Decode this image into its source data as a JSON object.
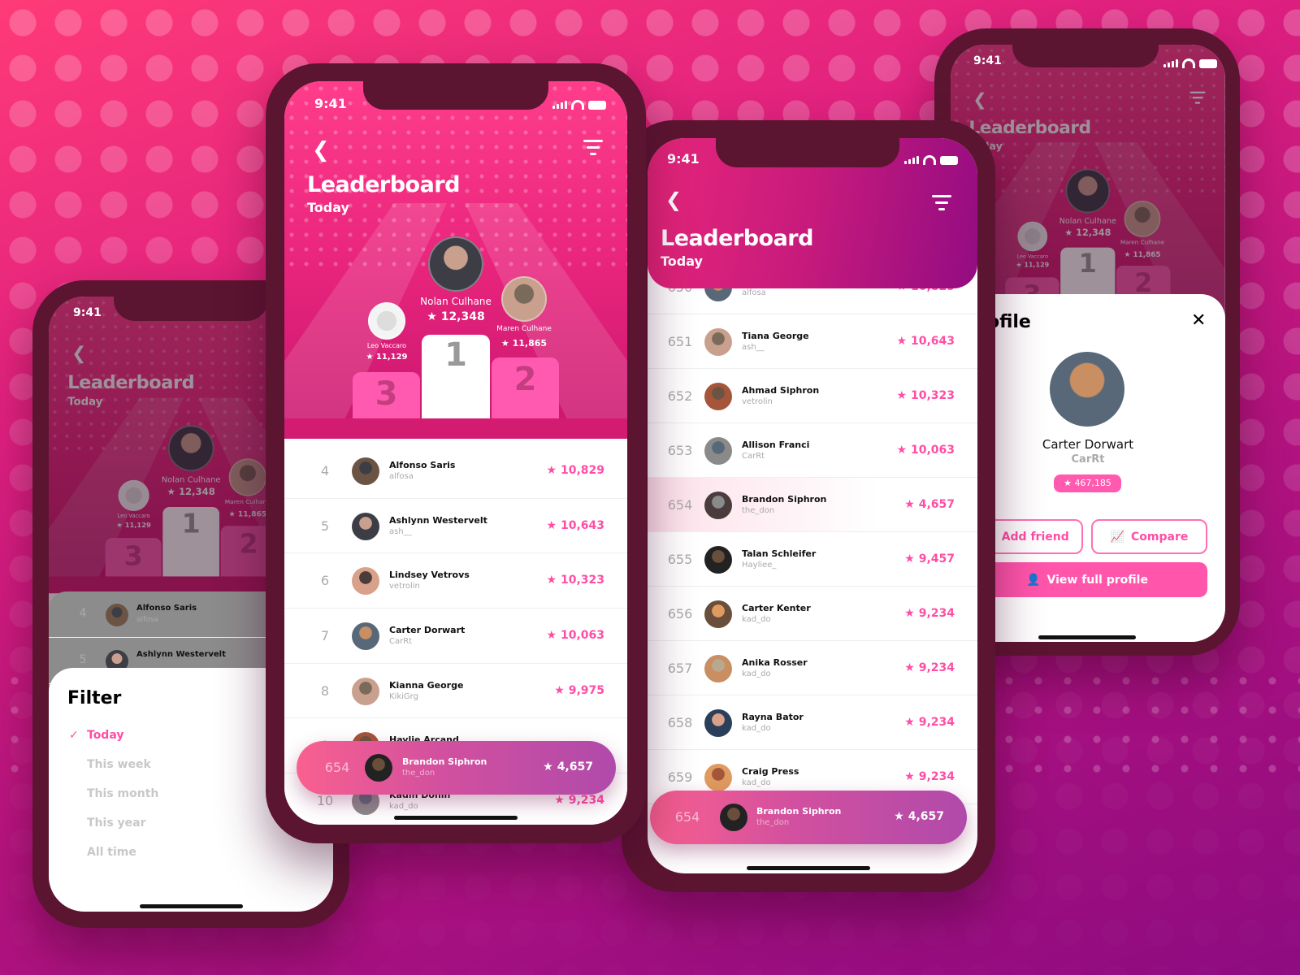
{
  "status_time": "9:41",
  "header": {
    "title": "Leaderboard",
    "subtitle": "Today"
  },
  "podium": [
    {
      "place": "1",
      "name": "Nolan Culhane",
      "score": "12,348"
    },
    {
      "place": "2",
      "name": "Maren Culhane",
      "score": "11,865"
    },
    {
      "place": "3",
      "name": "Leo Vaccaro",
      "score": "11,129"
    }
  ],
  "center_list": [
    {
      "rank": "4",
      "name": "Alfonso Saris",
      "handle": "alfosa",
      "score": "10,829"
    },
    {
      "rank": "5",
      "name": "Ashlynn Westervelt",
      "handle": "ash__",
      "score": "10,643"
    },
    {
      "rank": "6",
      "name": "Lindsey Vetrovs",
      "handle": "vetrolin",
      "score": "10,323"
    },
    {
      "rank": "7",
      "name": "Carter Dorwart",
      "handle": "CarRt",
      "score": "10,063"
    },
    {
      "rank": "8",
      "name": "Kianna George",
      "handle": "KikiGrg",
      "score": "9,975"
    },
    {
      "rank": "9",
      "name": "Haylie Arcand",
      "handle": "",
      "score": ""
    },
    {
      "rank": "10",
      "name": "Kadin Donin",
      "handle": "kad_do",
      "score": "9,234"
    }
  ],
  "right_list": [
    {
      "rank": "650",
      "name": "",
      "handle": "alfosa",
      "score": "10,829"
    },
    {
      "rank": "651",
      "name": "Tiana George",
      "handle": "ash__",
      "score": "10,643"
    },
    {
      "rank": "652",
      "name": "Ahmad Siphron",
      "handle": "vetrolin",
      "score": "10,323"
    },
    {
      "rank": "653",
      "name": "Allison Franci",
      "handle": "CarRt",
      "score": "10,063"
    },
    {
      "rank": "654",
      "name": "Brandon Siphron",
      "handle": "the_don",
      "score": "4,657",
      "highlight": true
    },
    {
      "rank": "655",
      "name": "Talan Schleifer",
      "handle": "Hayliee_",
      "score": "9,457"
    },
    {
      "rank": "656",
      "name": "Carter Kenter",
      "handle": "kad_do",
      "score": "9,234"
    },
    {
      "rank": "657",
      "name": "Anika Rosser",
      "handle": "kad_do",
      "score": "9,234"
    },
    {
      "rank": "658",
      "name": "Rayna Bator",
      "handle": "kad_do",
      "score": "9,234"
    },
    {
      "rank": "659",
      "name": "Craig Press",
      "handle": "kad_do",
      "score": "9,234"
    }
  ],
  "current_user": {
    "rank": "654",
    "name": "Brandon Siphron",
    "handle": "the_don",
    "score": "4,657"
  },
  "filter": {
    "title": "Filter",
    "options": [
      "Today",
      "This week",
      "This month",
      "This year",
      "All time"
    ],
    "selected": "Today"
  },
  "left_list": [
    {
      "rank": "4",
      "name": "Alfonso Saris",
      "handle": "alfosa"
    },
    {
      "rank": "5",
      "name": "Ashlynn Westervelt",
      "handle": ""
    }
  ],
  "profile": {
    "title": "Profile",
    "name": "Carter Dorwart",
    "handle": "CarRt",
    "score": "467,185",
    "add_friend": "Add friend",
    "compare": "Compare",
    "view_full": "View full profile"
  },
  "icons": {
    "star": "star-icon",
    "back": "chevron-left-icon",
    "filter": "filter-icon",
    "close": "close-icon",
    "check": "check-icon"
  },
  "colors": {
    "accent": "#ff4da6",
    "podium_pink": "#ff5aaf",
    "frame": "#5c1530"
  }
}
